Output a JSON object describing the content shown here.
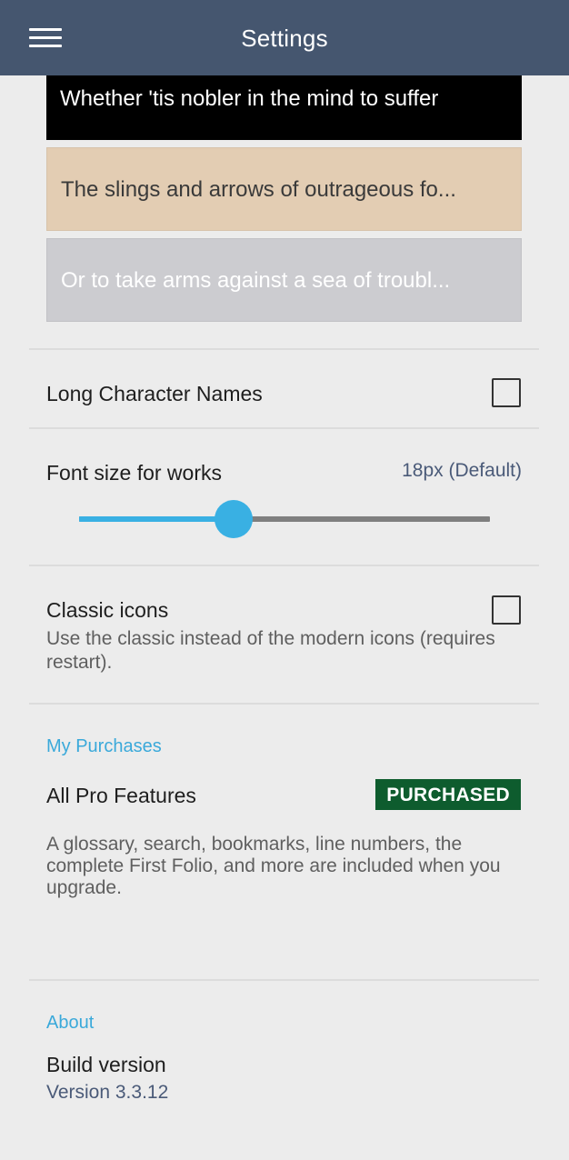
{
  "app_bar": {
    "title": "Settings",
    "menu_icon": "hamburger-menu-icon",
    "background": "#45566f"
  },
  "themes": [
    {
      "sample_text": "Whether 'tis nobler in the mind to suffer",
      "background": "#000000",
      "text_color": "#ffffff"
    },
    {
      "sample_text": "The slings and arrows of outrageous fo...",
      "background": "#e3cdb3",
      "text_color": "#3a3a3a"
    },
    {
      "sample_text": "Or to take arms against a sea of troubl...",
      "background": "#ccccd0",
      "text_color": "#ffffff"
    }
  ],
  "long_character_names": {
    "label": "Long Character Names",
    "checked": false
  },
  "font_size": {
    "label": "Font size for works",
    "value_label": "18px (Default)",
    "slider_fraction": 0.375
  },
  "classic_icons": {
    "label": "Classic icons",
    "description": "Use the classic instead of the modern icons (requires restart).",
    "checked": false
  },
  "purchases": {
    "header": "My Purchases",
    "item_label": "All Pro Features",
    "badge": "PURCHASED",
    "description": "A glossary, search, bookmarks, line numbers, the complete First Folio, and more are included when you upgrade."
  },
  "about": {
    "header": "About",
    "build_label": "Build version",
    "version": "Version 3.3.12"
  },
  "colors": {
    "accent": "#39b0e3",
    "badge_green": "#0e5c2e",
    "secondary_text": "#4a5a78"
  }
}
